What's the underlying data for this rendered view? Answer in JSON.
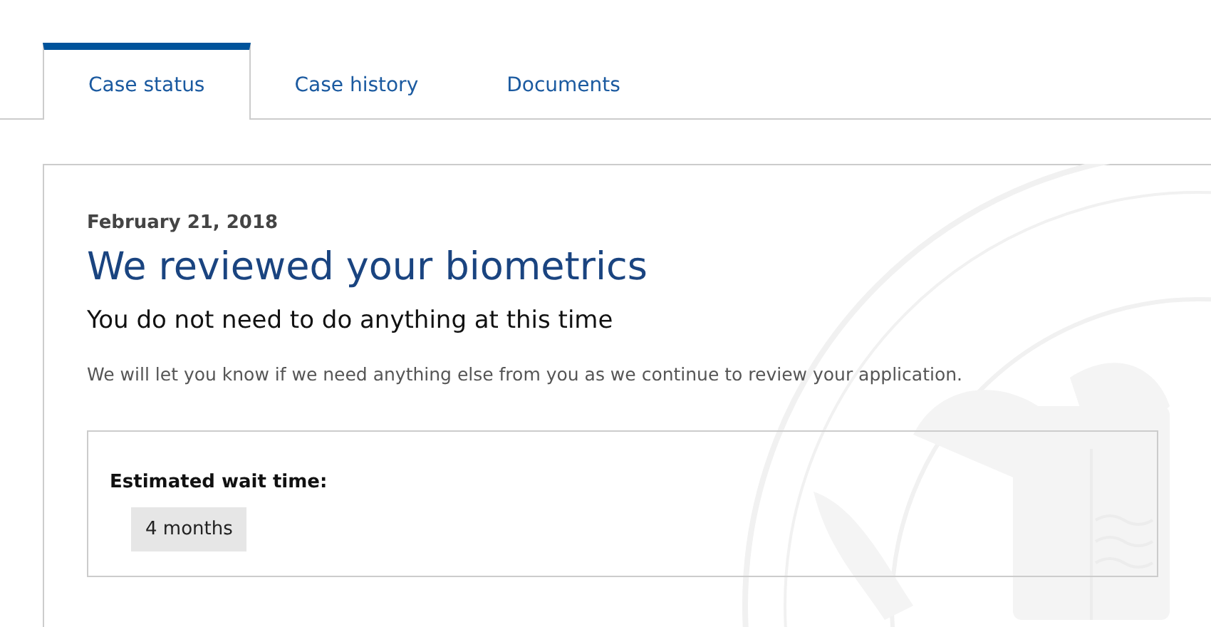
{
  "tabs": [
    {
      "label": "Case status",
      "selected": true
    },
    {
      "label": "Case history",
      "selected": false
    },
    {
      "label": "Documents",
      "selected": false
    }
  ],
  "status": {
    "date": "February 21, 2018",
    "title": "We reviewed your biometrics",
    "subtitle": "You do not need to do anything at this time",
    "message": "We will let you know if we need anything else from you as we continue to review your application."
  },
  "wait_time": {
    "label": "Estimated wait time:",
    "value": "4 months"
  }
}
